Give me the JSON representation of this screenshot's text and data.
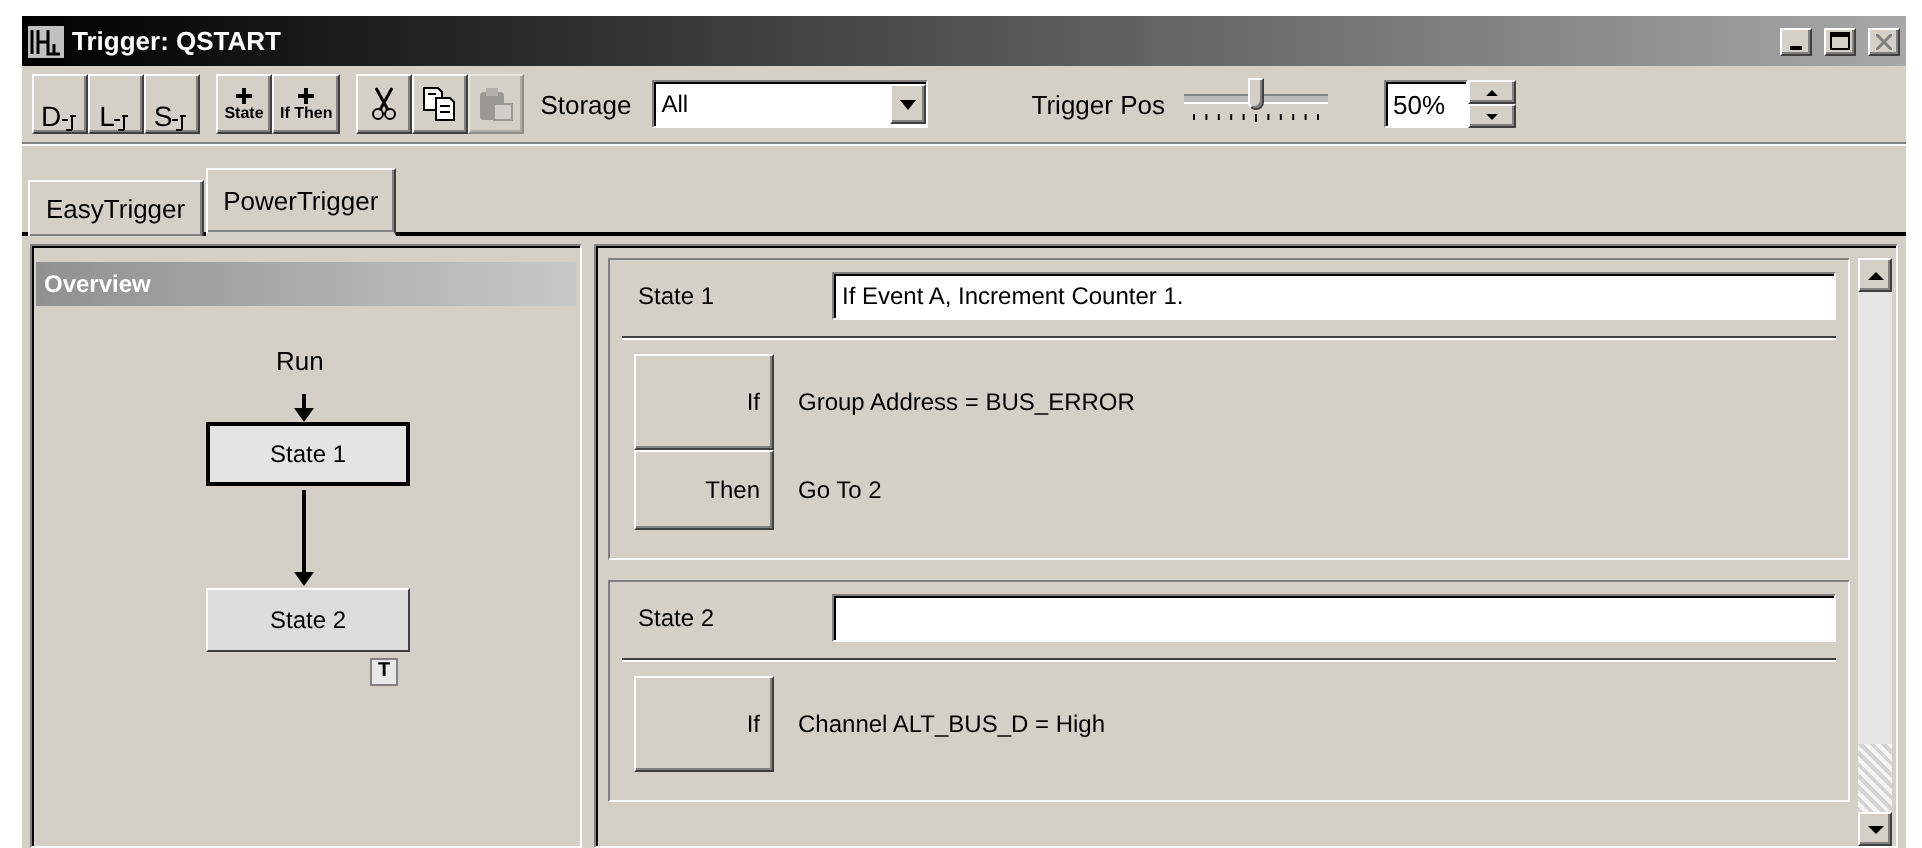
{
  "window": {
    "title": "Trigger: QSTART"
  },
  "toolbar": {
    "buttons": [
      {
        "kind": "probe",
        "label": "D",
        "disabled": false
      },
      {
        "kind": "probe",
        "label": "L",
        "disabled": false
      },
      {
        "kind": "probe",
        "label": "S",
        "disabled": false
      },
      {
        "kind": "add",
        "label": "State",
        "disabled": false
      },
      {
        "kind": "add",
        "label": "If Then",
        "disabled": false
      },
      {
        "kind": "cut",
        "disabled": false
      },
      {
        "kind": "copy",
        "disabled": false
      },
      {
        "kind": "paste",
        "disabled": true
      }
    ],
    "storage_label": "Storage",
    "storage_value": "All",
    "trigger_pos_label": "Trigger Pos",
    "trigger_pos": {
      "level": 0.5
    },
    "trigger_pos_value": "50%"
  },
  "tabs": [
    {
      "label": "EasyTrigger",
      "selected": false
    },
    {
      "label": "PowerTrigger",
      "selected": true
    }
  ],
  "overview": {
    "title": "Overview",
    "start_label": "Run",
    "nodes": [
      {
        "label": "State 1",
        "selected": true
      },
      {
        "label": "State 2",
        "selected": false,
        "badge": "T"
      }
    ]
  },
  "states": [
    {
      "name": "State 1",
      "description": "If Event A, Increment Counter 1.",
      "conditions": [
        {
          "keyword": "If",
          "text": "Group Address = BUS_ERROR"
        },
        {
          "keyword": "Then",
          "text": "Go To 2"
        }
      ]
    },
    {
      "name": "State 2",
      "conditions": [
        {
          "keyword": "If",
          "text": "Channel ALT_BUS_D = High"
        }
      ]
    }
  ]
}
